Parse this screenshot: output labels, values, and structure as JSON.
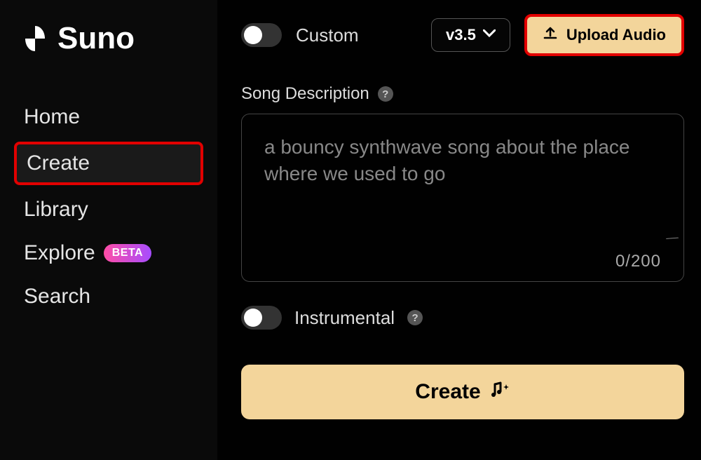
{
  "brand": {
    "name": "Suno"
  },
  "sidebar": {
    "items": [
      {
        "label": "Home"
      },
      {
        "label": "Create"
      },
      {
        "label": "Library"
      },
      {
        "label": "Explore",
        "badge": "BETA"
      },
      {
        "label": "Search"
      }
    ]
  },
  "top": {
    "custom_label": "Custom",
    "version": "v3.5",
    "upload_label": "Upload Audio"
  },
  "description": {
    "label": "Song Description",
    "placeholder": "a bouncy synthwave song about the place where we used to go",
    "counter": "0/200"
  },
  "instrumental": {
    "label": "Instrumental"
  },
  "create": {
    "label": "Create"
  }
}
